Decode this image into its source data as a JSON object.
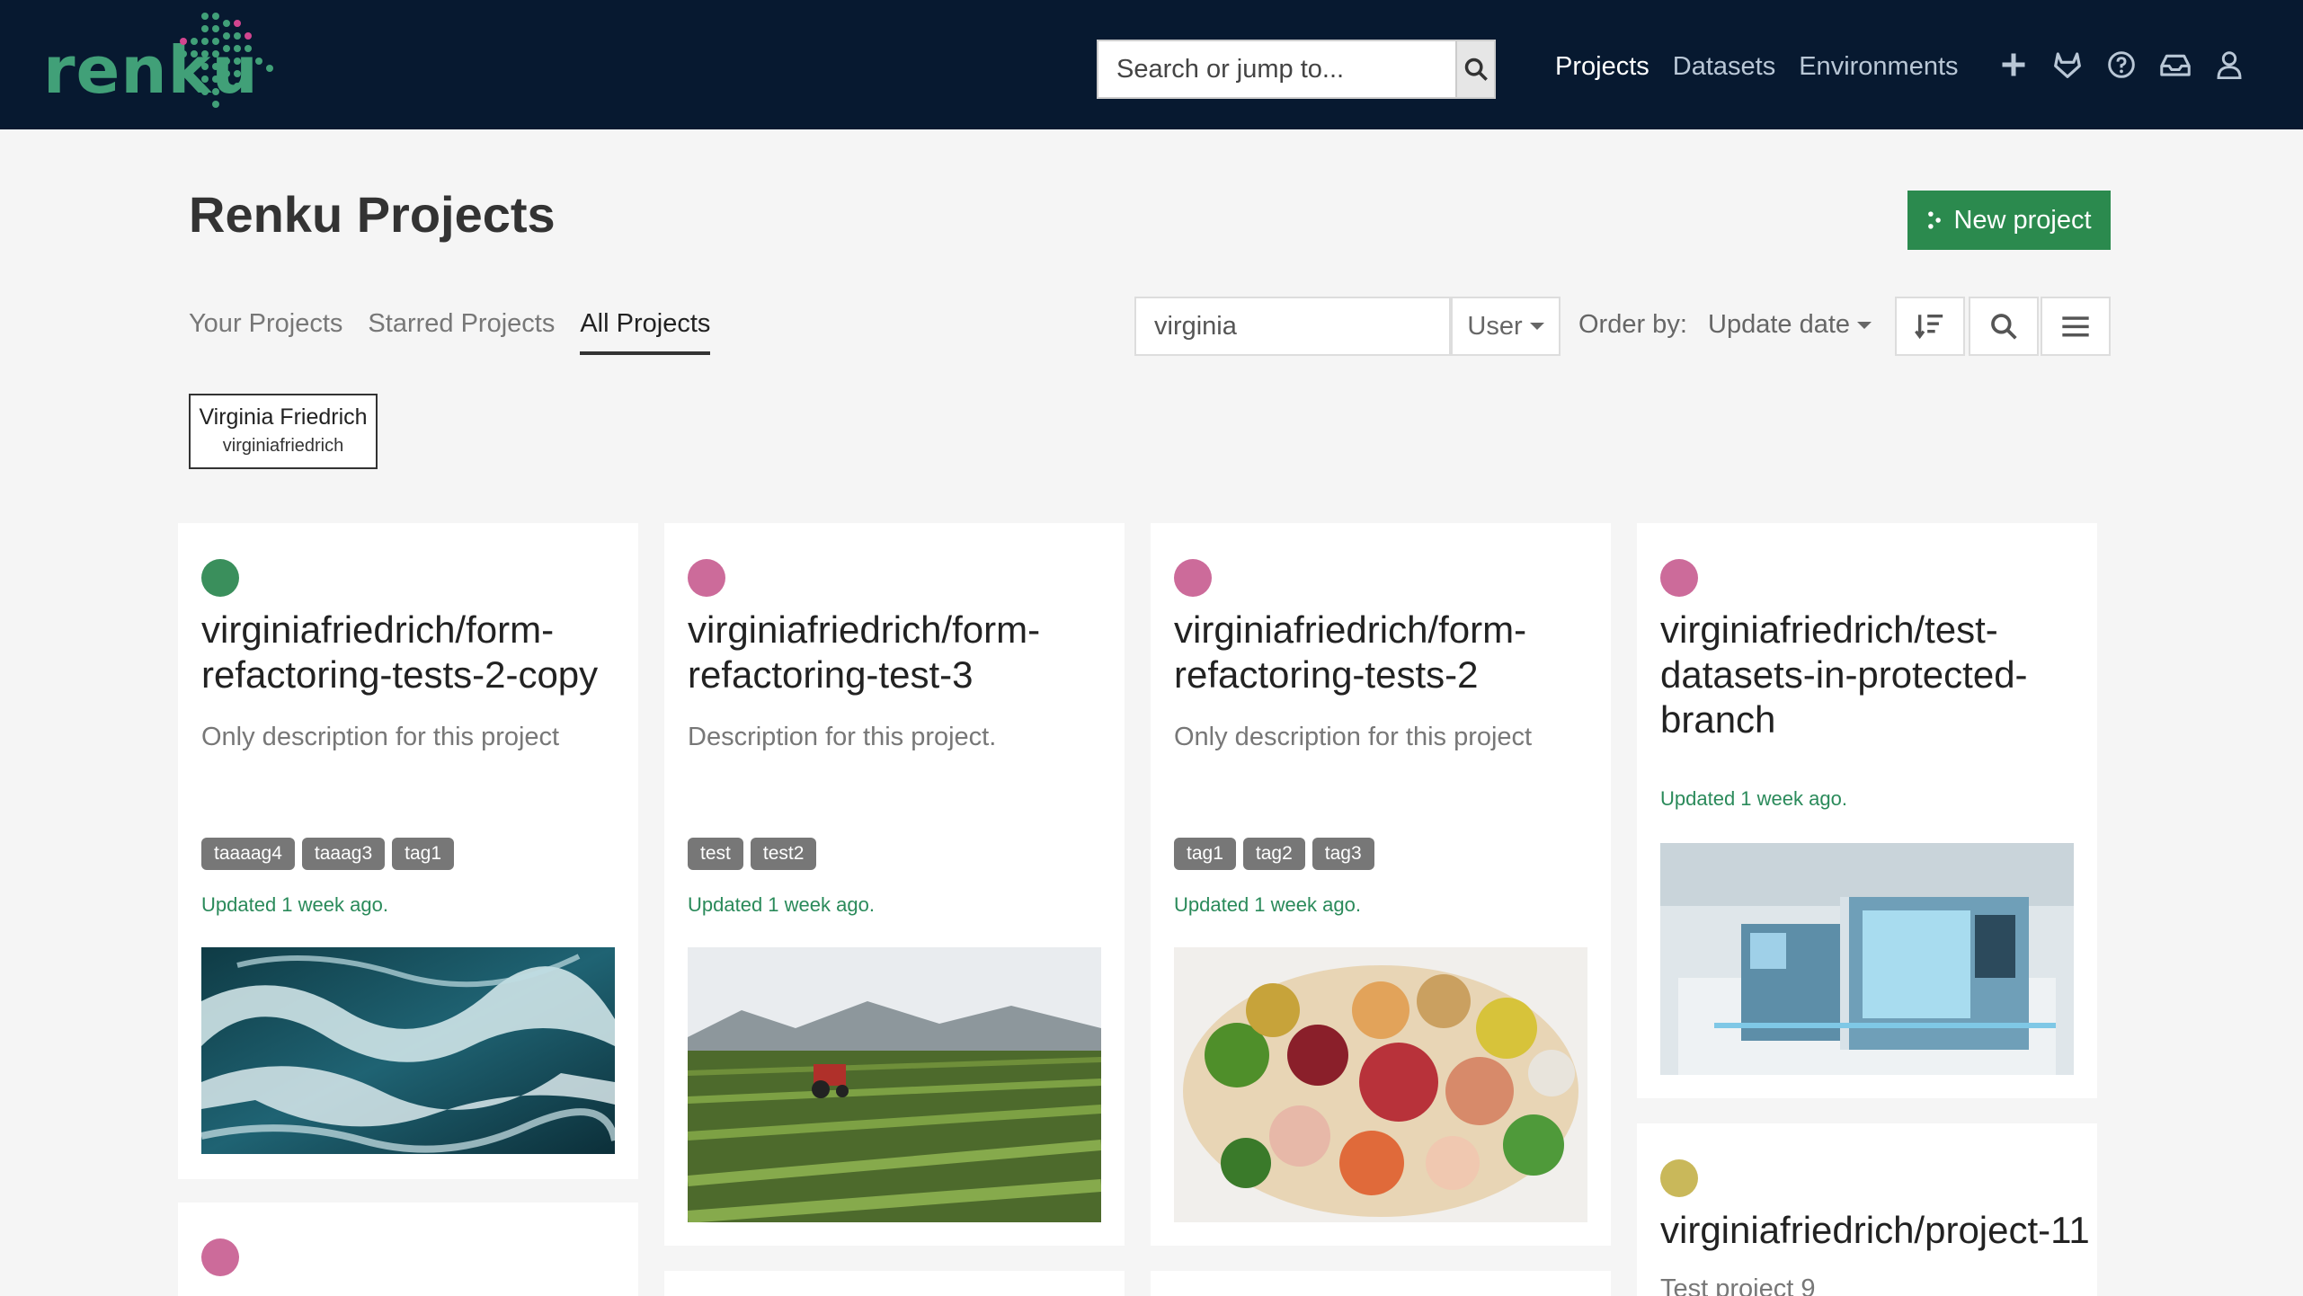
{
  "brand": {
    "logo_text": "renku"
  },
  "search": {
    "placeholder": "Search or jump to..."
  },
  "nav": {
    "links": [
      "Projects",
      "Datasets",
      "Environments"
    ],
    "active": "Projects"
  },
  "header": {
    "title": "Renku Projects",
    "new_project_label": "New project"
  },
  "tabs": [
    "Your Projects",
    "Starred Projects",
    "All Projects"
  ],
  "active_tab": "All Projects",
  "filter": {
    "query": "virginia",
    "scope": "User",
    "order_label": "Order by:",
    "order_value": "Update date"
  },
  "user_chip": {
    "name": "Virginia Friedrich",
    "handle": "virginiafriedrich"
  },
  "colors": {
    "navbar": "#071930",
    "brand_green": "#41a078",
    "primary_button": "#2b8a4e",
    "updated_text": "#2a8a5a"
  },
  "projects": [
    {
      "title": "virginiafriedrich/form-refactoring-tests-2-copy",
      "description": "Only description for this project",
      "tags": [
        "taaaag4",
        "taaag3",
        "tag1"
      ],
      "updated": "Updated 1 week ago.",
      "dot_color": "#3a8f5c",
      "image": "ocean-waves"
    },
    {
      "title": "virginiafriedrich/form-refactoring-test-3",
      "description": "Description for this project.",
      "tags": [
        "test",
        "test2"
      ],
      "updated": "Updated 1 week ago.",
      "dot_color": "#cc6b9a",
      "image": "tractor-field"
    },
    {
      "title": "virginiafriedrich/form-refactoring-tests-2",
      "description": "Only description for this project",
      "tags": [
        "tag1",
        "tag2",
        "tag3"
      ],
      "updated": "Updated 1 week ago.",
      "dot_color": "#cc6b9a",
      "image": "fresh-food"
    },
    {
      "title": "virginiafriedrich/test-datasets-in-protected-branch",
      "description": "",
      "tags": [],
      "updated": "Updated 1 week ago.",
      "dot_color": "#cc6b9a",
      "image": "industrial-machine"
    },
    {
      "title": "virginiafriedrich/project-11",
      "description": "Test project 9",
      "tags": [],
      "updated": "",
      "dot_color": "#c9b85a",
      "image": ""
    },
    {
      "title": "",
      "description": "",
      "tags": [],
      "updated": "",
      "dot_color": "#cc6b9a",
      "image": ""
    }
  ]
}
